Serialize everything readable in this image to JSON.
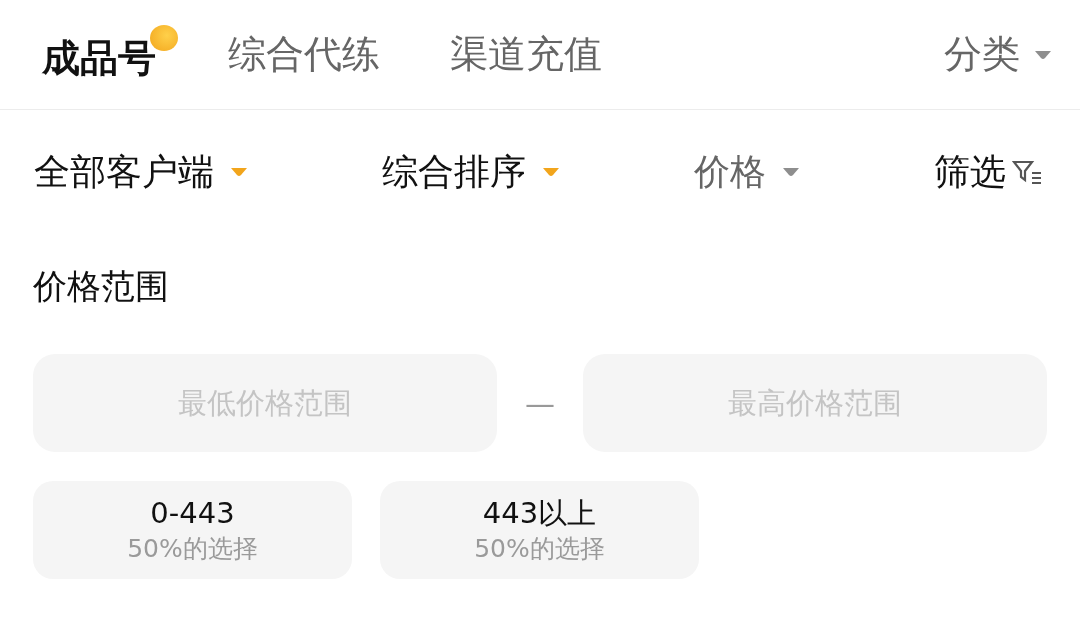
{
  "tabs": [
    {
      "label": "成品号",
      "selected": true
    },
    {
      "label": "综合代练",
      "selected": false
    },
    {
      "label": "渠道充值",
      "selected": false
    }
  ],
  "category": {
    "label": "分类"
  },
  "filters": [
    {
      "kind": "dropdown",
      "label": "全部客户端",
      "active": true
    },
    {
      "kind": "dropdown",
      "label": "综合排序",
      "active": true
    },
    {
      "kind": "dropdown",
      "label": "价格",
      "active": false
    },
    {
      "kind": "filter",
      "label": "筛选",
      "active": true
    }
  ],
  "price_range": {
    "title": "价格范围",
    "min_placeholder": "最低价格范围",
    "separator": "—",
    "max_placeholder": "最高价格范围",
    "presets": [
      {
        "range": "0-443",
        "share": "50%的选择",
        "selected": false
      },
      {
        "range": "443以上",
        "share": "50%的选择",
        "selected": false
      }
    ]
  }
}
